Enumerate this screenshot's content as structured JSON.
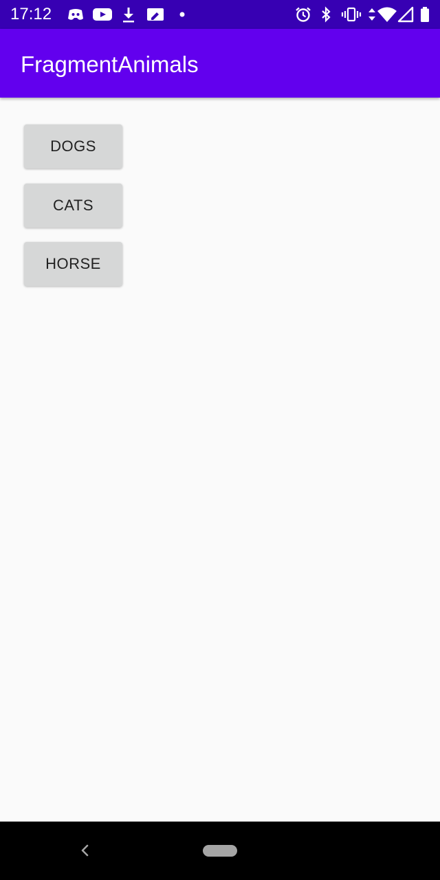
{
  "status_bar": {
    "time": "17:12",
    "left_icons": [
      "discord-icon",
      "youtube-icon",
      "download-icon",
      "sim-edit-icon",
      "dot-icon"
    ],
    "right_icons": [
      "alarm-icon",
      "bluetooth-icon",
      "vibrate-icon",
      "data-arrows-icon",
      "wifi-icon",
      "signal-icon",
      "battery-icon"
    ]
  },
  "app_bar": {
    "title": "FragmentAnimals",
    "color": "#6200ee",
    "status_color": "#3700b3"
  },
  "buttons": [
    {
      "label": "DOGS"
    },
    {
      "label": "CATS"
    },
    {
      "label": "HORSE"
    }
  ],
  "nav_bar": {
    "icons": [
      "back-icon",
      "home-pill-icon"
    ]
  }
}
